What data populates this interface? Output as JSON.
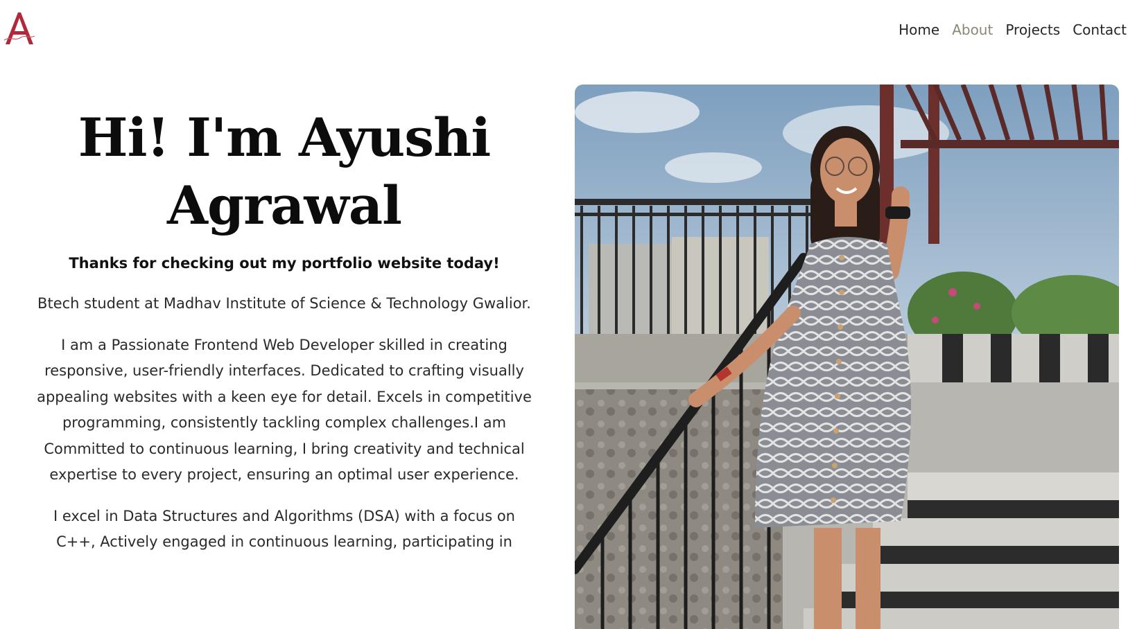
{
  "header": {
    "logo_letter": "A",
    "nav": [
      {
        "label": "Home",
        "active": false
      },
      {
        "label": "About",
        "active": true
      },
      {
        "label": "Projects",
        "active": false
      },
      {
        "label": "Contact",
        "active": false
      }
    ]
  },
  "hero": {
    "title_line1": "Hi! I'm Ayushi",
    "title_line2": "Agrawal",
    "tagline": "Thanks for checking out my portfolio website today!",
    "paragraph1": "Btech student at Madhav Institute of Science & Technology Gwalior.",
    "paragraph2": "I am a Passionate Frontend Web Developer skilled in creating responsive, user-friendly interfaces. Dedicated to crafting visually appealing websites with a keen eye for detail. Excels in competitive programming, consistently tackling complex challenges.I am Committed to continuous learning, I bring creativity and technical expertise to every project, ensuring an optimal user experience.",
    "paragraph3": "I excel in Data Structures and Algorithms (DSA) with a focus on C++, Actively engaged in continuous learning, participating in"
  },
  "colors": {
    "logo": "#b0283a",
    "nav_active": "#8b8676",
    "text": "#2a2a2a"
  },
  "icons": {
    "logo": "monogram-a-logo"
  }
}
